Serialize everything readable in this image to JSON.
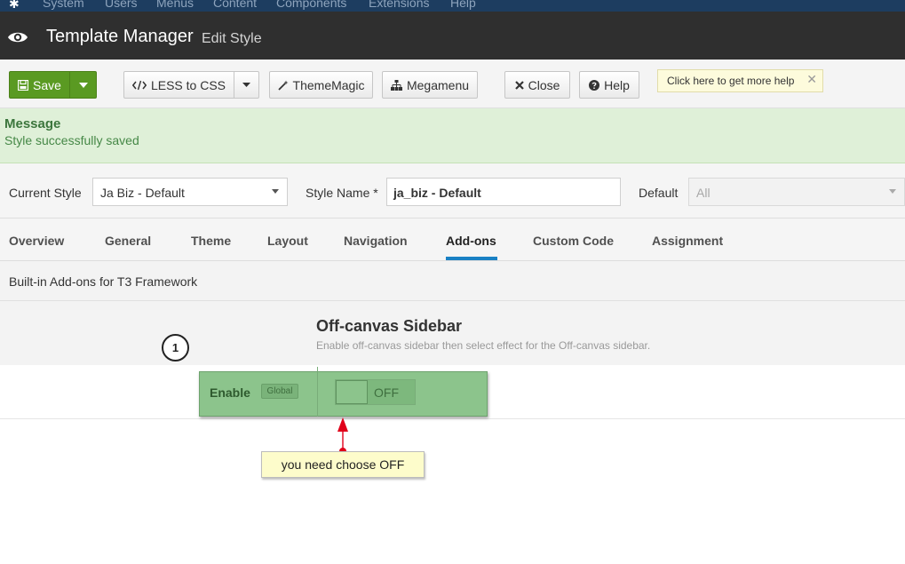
{
  "topmenu": {
    "items": [
      "System",
      "Users",
      "Menus",
      "Content",
      "Components",
      "Extensions",
      "Help"
    ]
  },
  "header": {
    "title": "Template Manager",
    "subtitle": "Edit Style"
  },
  "toolbar": {
    "save": "Save",
    "less": "LESS to CSS",
    "thememagic": "ThemeMagic",
    "megamenu": "Megamenu",
    "close": "Close",
    "help": "Help",
    "tip": "Click here to get more help"
  },
  "message": {
    "heading": "Message",
    "text": "Style successfully saved"
  },
  "style": {
    "current_label": "Current Style",
    "current_value": "Ja Biz - Default",
    "name_label": "Style Name *",
    "name_value": "ja_biz - Default",
    "default_label": "Default",
    "default_value": "All"
  },
  "tabs": [
    "Overview",
    "General",
    "Theme",
    "Layout",
    "Navigation",
    "Add-ons",
    "Custom Code",
    "Assignment"
  ],
  "active_tab": "Add-ons",
  "addons": {
    "description": "Built-in Add-ons for T3 Framework",
    "section_title": "Off-canvas Sidebar",
    "section_sub": "Enable off-canvas sidebar then select effect for the Off-canvas sidebar.",
    "enable_label": "Enable",
    "global_badge": "Global",
    "toggle_state": "OFF"
  },
  "annotation": {
    "step": "1",
    "callout": "you need choose OFF"
  },
  "colors": {
    "save_green": "#5a9a22",
    "highlight_green": "#8cc48c",
    "tab_indicator": "#1a81c4",
    "arrow_red": "#e0001a"
  }
}
